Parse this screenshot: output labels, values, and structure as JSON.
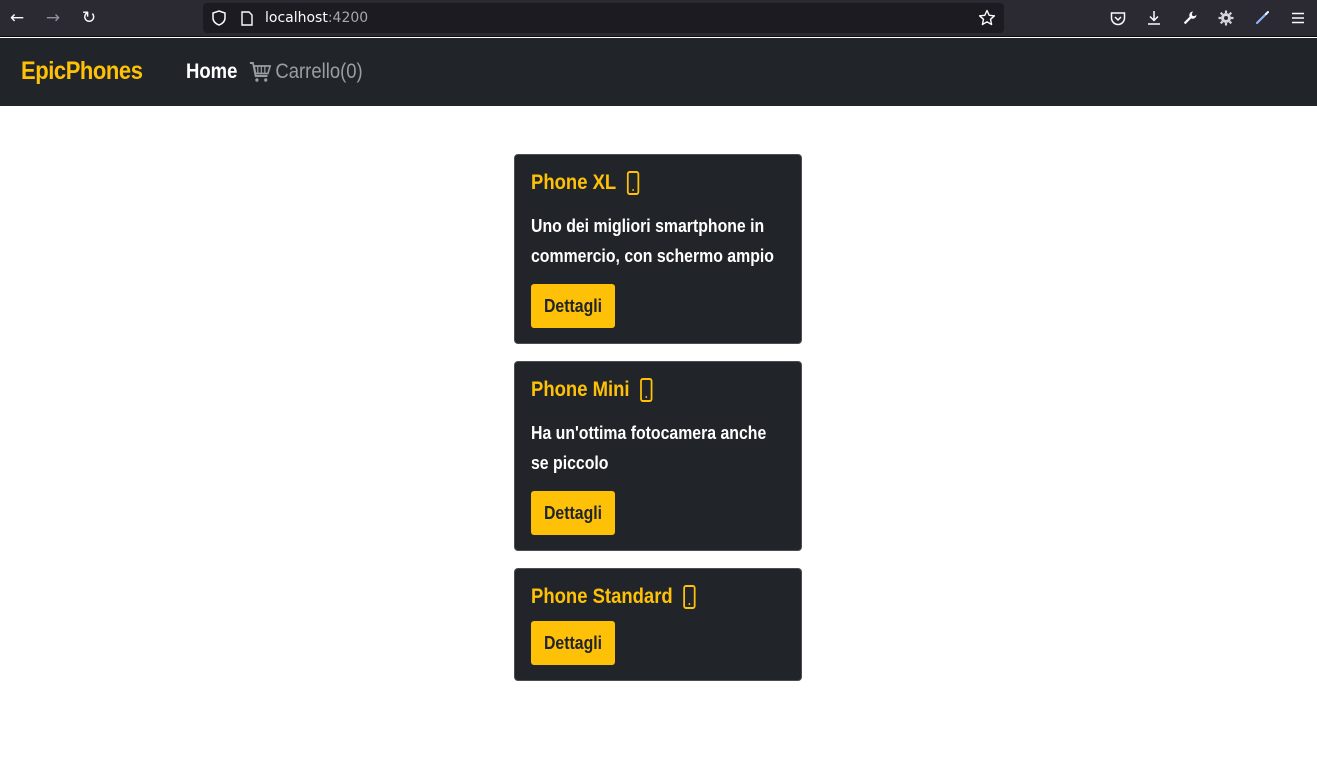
{
  "browser": {
    "url_host": "localhost",
    "url_port": ":4200"
  },
  "navbar": {
    "brand": "EpicPhones",
    "home_label": "Home",
    "cart_label": "Carrello(0)"
  },
  "products": [
    {
      "name": "Phone XL",
      "description": "Uno dei migliori smartphone in commercio, con schermo ampio",
      "button": "Dettagli"
    },
    {
      "name": "Phone Mini",
      "description": "Ha un'ottima fotocamera anche se piccolo",
      "button": "Dettagli"
    },
    {
      "name": "Phone Standard",
      "description": "",
      "button": "Dettagli"
    }
  ],
  "colors": {
    "accent": "#ffc107",
    "dark": "#212529"
  }
}
